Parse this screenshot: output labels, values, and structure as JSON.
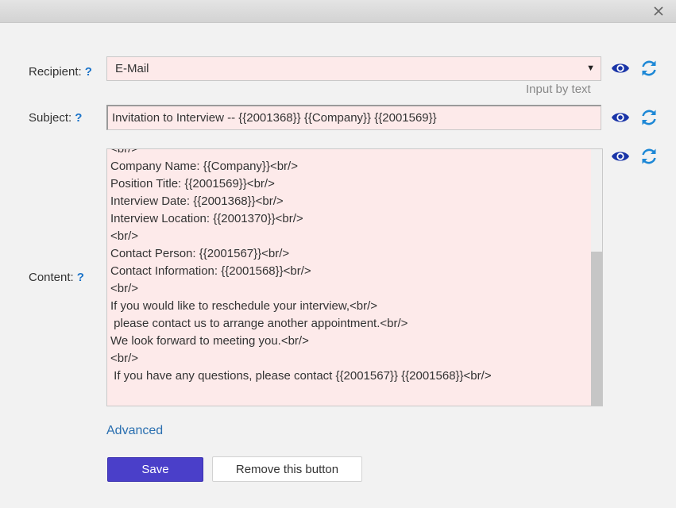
{
  "dialog": {
    "close_icon": "close-icon"
  },
  "recipient": {
    "label": "Recipient:",
    "help": "?",
    "value": "E-Mail",
    "hint": "Input by text"
  },
  "subject": {
    "label": "Subject:",
    "help": "?",
    "value": "Invitation to Interview -- {{2001368}} {{Company}} {{2001569}}"
  },
  "content": {
    "label": "Content:",
    "help": "?",
    "lines": [
      "<br/>",
      "Company Name: {{Company}}<br/>",
      "Position Title: {{2001569}}<br/>",
      "Interview Date: {{2001368}}<br/>",
      "Interview Location: {{2001370}}<br/>",
      "<br/>",
      "Contact Person: {{2001567}}<br/>",
      "Contact Information: {{2001568}}<br/>",
      "<br/>",
      "If you would like to reschedule your interview,<br/>",
      " please contact us to arrange another appointment.<br/>",
      "We look forward to meeting you.<br/>",
      "<br/>",
      " If you have any questions, please contact {{2001567}} {{2001568}}<br/>"
    ]
  },
  "icons": {
    "preview": "eye-icon",
    "refresh": "refresh-icon"
  },
  "colors": {
    "field_bg": "#fdeaea",
    "accent": "#1a73c9",
    "save_bg": "#4a3fc9"
  },
  "advanced_link": "Advanced",
  "buttons": {
    "save": "Save",
    "remove": "Remove this button"
  }
}
